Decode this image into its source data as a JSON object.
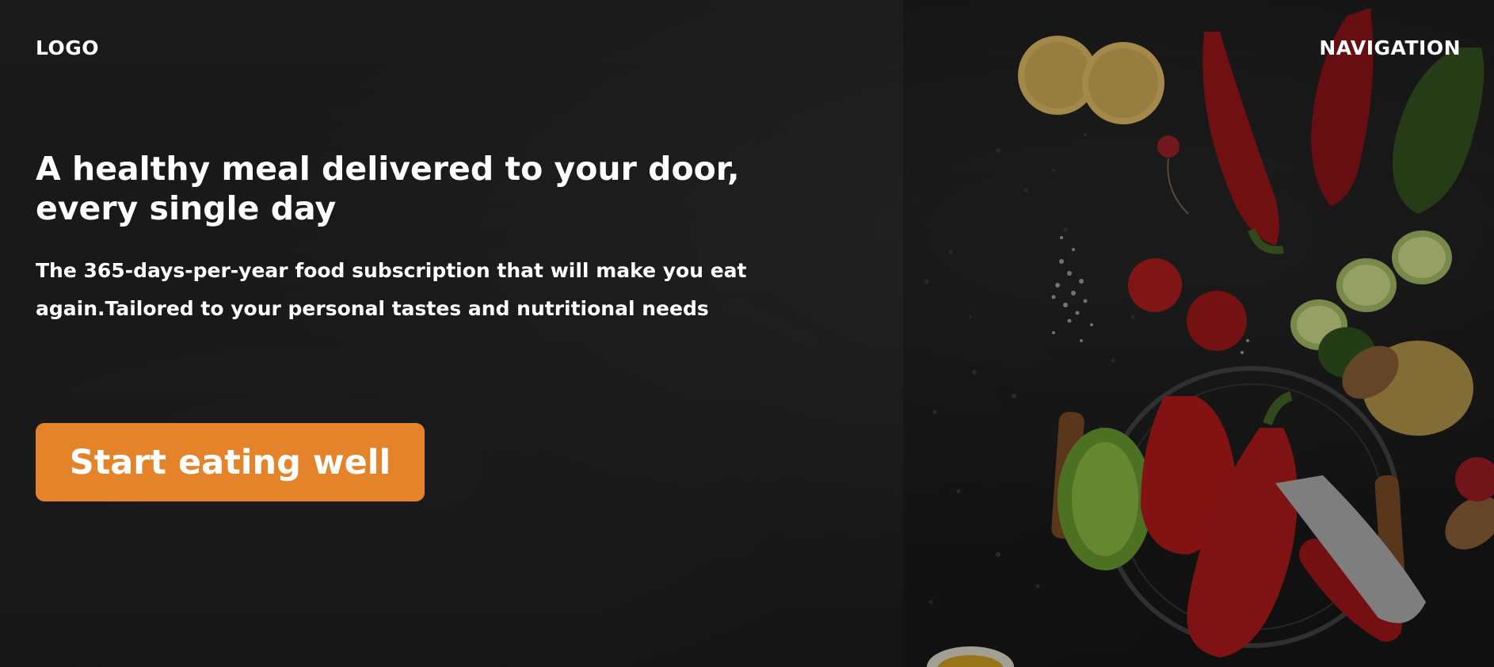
{
  "header": {
    "logo": "LOGO",
    "navigation": "NAVIGATION"
  },
  "hero": {
    "headline": "A healthy meal delivered to your door, every single day",
    "subtext": "The 365-days-per-year food subscription that will make you eat again.Tailored to your personal tastes and nutritional needs",
    "cta_label": "Start eating well",
    "background_image": "vegetables-on-dark-slate"
  },
  "colors": {
    "accent": "#e5832a",
    "text": "#ffffff",
    "background": "#161616"
  }
}
